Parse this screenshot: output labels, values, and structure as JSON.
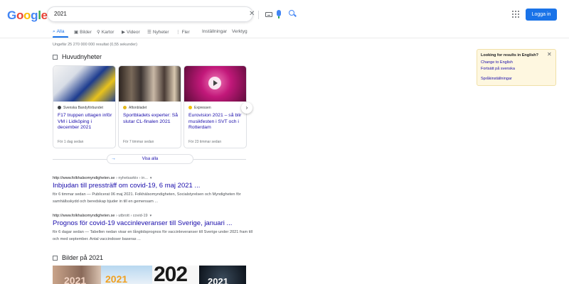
{
  "header": {
    "logo": [
      "G",
      "o",
      "o",
      "g",
      "l",
      "e"
    ],
    "logo_colors": [
      "#4285f4",
      "#ea4335",
      "#fbbc05",
      "#4285f4",
      "#34a853",
      "#ea4335"
    ],
    "search_query": "2021",
    "login_label": "Logga in"
  },
  "tabs": [
    {
      "label": "Alla",
      "icon": "search-icon",
      "active": true
    },
    {
      "label": "Bilder",
      "icon": "image-icon"
    },
    {
      "label": "Kartor",
      "icon": "map-pin-icon"
    },
    {
      "label": "Videor",
      "icon": "video-icon"
    },
    {
      "label": "Nyheter",
      "icon": "newspaper-icon"
    },
    {
      "label": "Fler",
      "icon": "more-icon"
    },
    {
      "label": "Inställningar"
    },
    {
      "label": "Verktyg"
    }
  ],
  "stats": "Ungefär 25 270 000 000 resultat (0,55 sekunder)",
  "top_news": {
    "heading": "Huvudnyheter",
    "view_all": "Visa alla",
    "cards": [
      {
        "source": "Svenska Bandyförbundet",
        "title": "F17 truppen uttagen inför VM i Lidköping i december 2021",
        "time": "För 1 dag sedan"
      },
      {
        "source": "Aftonbladet",
        "title": "Sportbladets experter: Så slutar CL-finalen 2021",
        "time": "För 7 timmar sedan"
      },
      {
        "source": "Expressen",
        "title": "Eurovision 2021 – så blir musikfesten i SVT och i Rotterdam",
        "time": "För 23 timmar sedan"
      }
    ]
  },
  "results": [
    {
      "url": "http://www.folkhalsomyndigheten.se",
      "crumb": "› nyhetsarkiv › in...",
      "title": "Inbjudan till pressträff om covid-19, 6 maj 2021 ...",
      "snippet": "för 6 timmar sedan — Publicerat 06 maj 2021. Folkhälsomyndigheten, Socialstyrelsen och Myndigheten för samhällsskydd och beredskap bjuder in till en gemensam ..."
    },
    {
      "url": "http://www.folkhalsomyndigheten.se",
      "crumb": "› utbrott › covid-19",
      "title": "Prognos för covid-19 vaccinleveranser till Sverige, januari ...",
      "snippet": "för 6 dagar sedan — Tabellen nedan visar en långtidsprognos för vaccinleveranser till Sverige under 2021 fram till och med september. Antal vaccindoser baseras ..."
    }
  ],
  "images": {
    "heading": "Bilder på 2021",
    "texts": [
      "2021",
      "2021",
      "202",
      "2021"
    ]
  },
  "english_panel": {
    "title": "Looking for results in English?",
    "change": "Change to English",
    "keep": "Fortsätt på svenska",
    "settings": "Språkinställningar"
  }
}
